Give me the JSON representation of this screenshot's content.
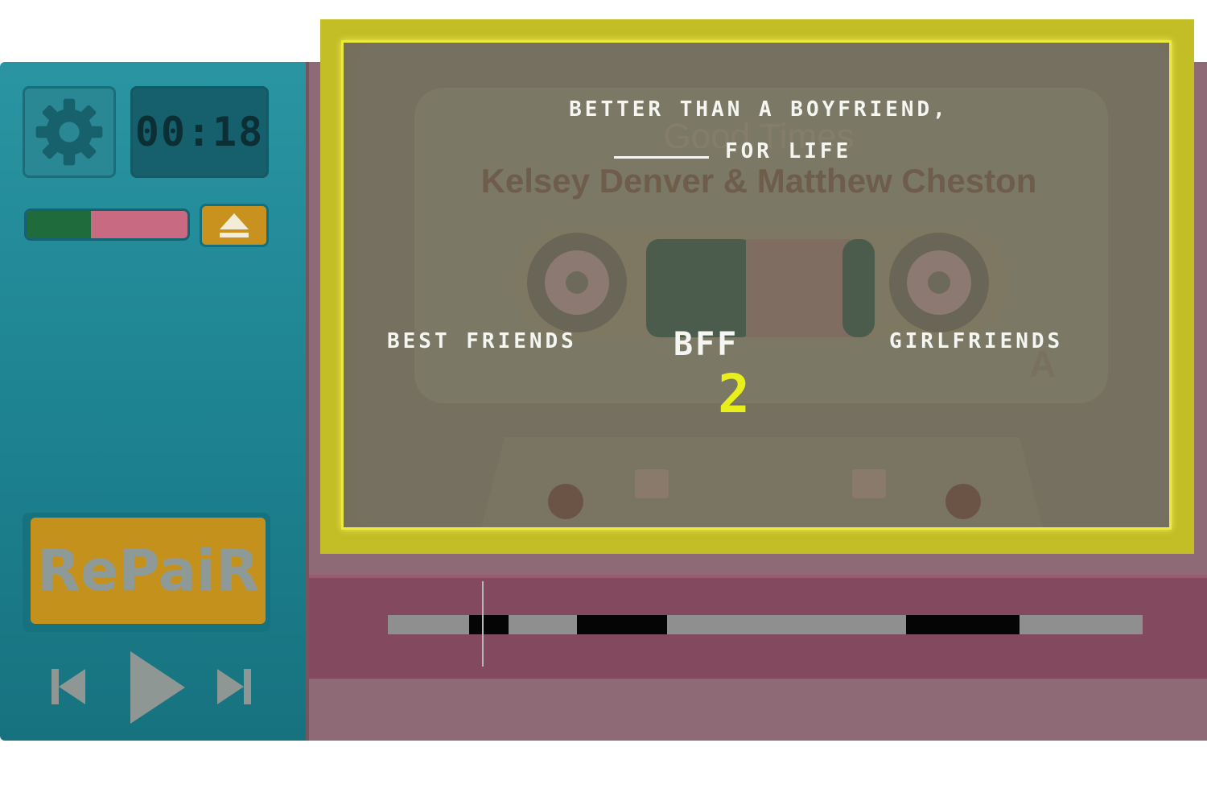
{
  "timer": "00:18",
  "health": {
    "fraction": 0.4
  },
  "repair_label": "RePaiR",
  "cassette": {
    "title": "Good Times",
    "artist": "Kelsey Denver & Matthew Cheston",
    "side": "A"
  },
  "question": {
    "line1": "Better than a boyfriend,",
    "line2": "for life"
  },
  "options": {
    "left": "Best friends",
    "center": "BFF",
    "right": "Girlfriends"
  },
  "countdown": "2",
  "icons": {
    "settings": "gear-icon",
    "eject": "eject-icon",
    "previous": "skip-back-icon",
    "play": "play-icon",
    "next": "skip-forward-icon"
  },
  "colors": {
    "accent_yellow": "#ecea3c",
    "countdown": "#e7f01a",
    "panel_teal": "#1f8593",
    "cassette_pink": "#8d6a76"
  },
  "timeline": {
    "segments": [
      [
        0.108,
        0.16
      ],
      [
        0.25,
        0.37
      ],
      [
        0.687,
        0.837
      ]
    ],
    "playhead": 0.125
  }
}
